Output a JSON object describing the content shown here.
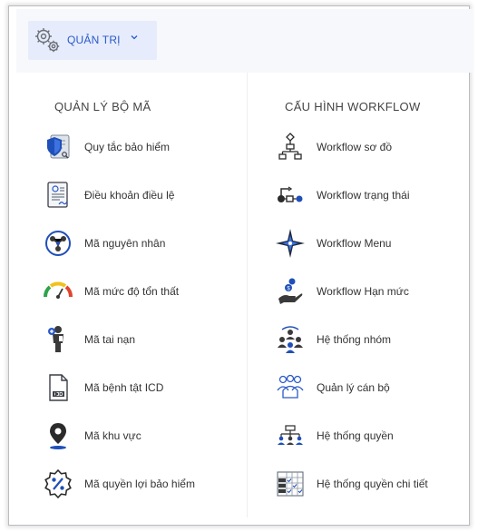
{
  "header": {
    "menu_label": "QUẢN TRỊ",
    "accent": "#2a59c9",
    "icon": "gear-icon"
  },
  "columns": [
    {
      "title": "QUẢN LÝ BỘ MÃ",
      "items": [
        {
          "label": "Quy tắc bảo hiểm",
          "icon": "shield-document-icon"
        },
        {
          "label": "Điều khoản điều lệ",
          "icon": "contract-document-icon"
        },
        {
          "label": "Mã nguyên nhân",
          "icon": "cause-diagram-icon"
        },
        {
          "label": "Mã mức độ tổn thất",
          "icon": "gauge-icon"
        },
        {
          "label": "Mã tai nạn",
          "icon": "injured-person-icon"
        },
        {
          "label": "Mã bệnh tật ICD",
          "icon": "icd-file-icon"
        },
        {
          "label": "Mã khu vực",
          "icon": "location-pin-icon"
        },
        {
          "label": "Mã quyền lợi bảo hiểm",
          "icon": "percent-badge-icon"
        }
      ]
    },
    {
      "title": "CẤU HÌNH WORKFLOW",
      "items": [
        {
          "label": "Workflow sơ đồ",
          "icon": "flowchart-icon"
        },
        {
          "label": "Workflow trạng thái",
          "icon": "workflow-state-icon"
        },
        {
          "label": "Workflow Menu",
          "icon": "compass-star-icon"
        },
        {
          "label": "Workflow Hạn mức",
          "icon": "money-hand-icon"
        },
        {
          "label": "Hệ thống nhóm",
          "icon": "group-icon"
        },
        {
          "label": "Quản lý cán bộ",
          "icon": "staff-icon"
        },
        {
          "label": "Hệ thống quyền",
          "icon": "permission-tree-icon"
        },
        {
          "label": "Hệ thống quyền chi tiết",
          "icon": "permission-table-icon"
        }
      ]
    }
  ]
}
